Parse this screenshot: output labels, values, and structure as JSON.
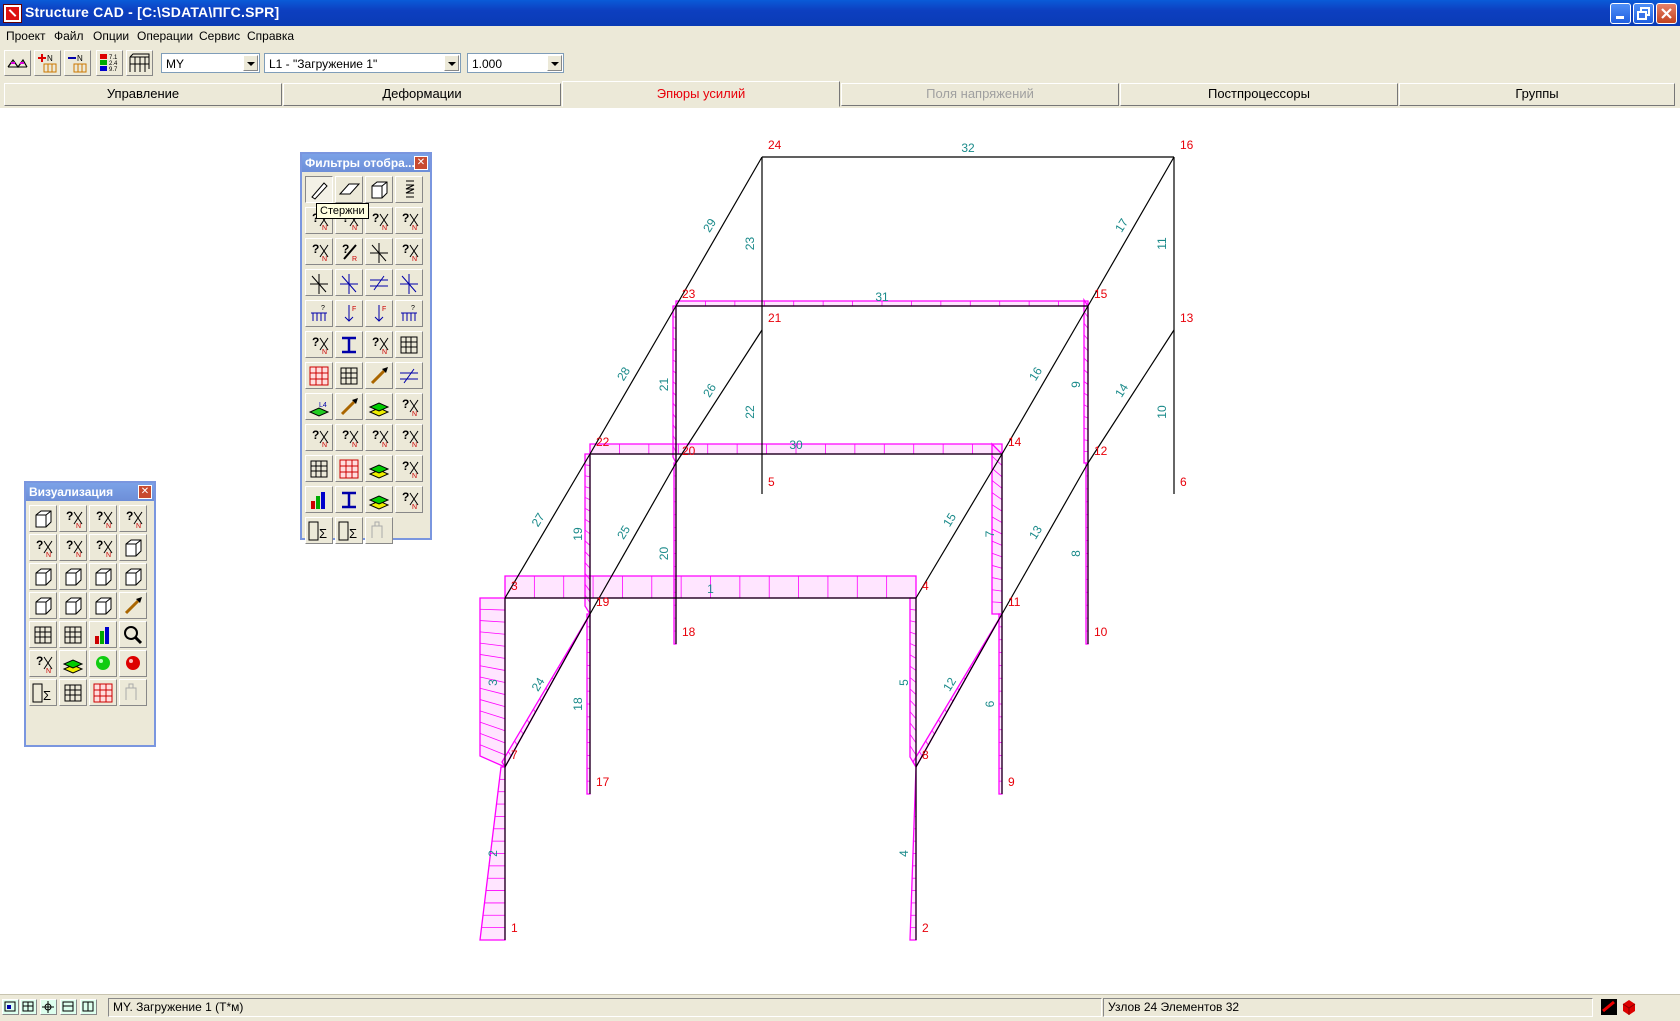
{
  "window": {
    "title": "Structure CAD  - [C:\\SDATA\\ПГС.SPR]"
  },
  "menu": [
    "Проект",
    "Файл",
    "Опции",
    "Операции",
    "Сервис",
    "Справка"
  ],
  "toolbar": {
    "combo_factor": "MY",
    "combo_load": "L1 - \"Загружение 1\"",
    "combo_scale": "1.000"
  },
  "tabs": [
    {
      "label": "Управление",
      "state": "normal"
    },
    {
      "label": "Деформации",
      "state": "normal"
    },
    {
      "label": "Эпюры усилий",
      "state": "active"
    },
    {
      "label": "Поля напряжений",
      "state": "disabled"
    },
    {
      "label": "Постпроцессоры",
      "state": "normal"
    },
    {
      "label": "Группы",
      "state": "normal"
    }
  ],
  "filters_panel": {
    "title": "Фильтры отобра...",
    "tooltip": "Стержни"
  },
  "visual_panel": {
    "title": "Визуализация"
  },
  "colors": {
    "node_label": "#e8000a",
    "element_label": "#1a8a8a",
    "diagram": "#ff00ff",
    "active_tab": "#e8000a"
  },
  "model": {
    "nodes": [
      {
        "id": "1"
      },
      {
        "id": "2"
      },
      {
        "id": "3"
      },
      {
        "id": "4"
      },
      {
        "id": "5"
      },
      {
        "id": "6"
      },
      {
        "id": "7"
      },
      {
        "id": "8"
      },
      {
        "id": "9"
      },
      {
        "id": "10"
      },
      {
        "id": "11"
      },
      {
        "id": "12"
      },
      {
        "id": "13"
      },
      {
        "id": "14"
      },
      {
        "id": "15"
      },
      {
        "id": "16"
      },
      {
        "id": "17"
      },
      {
        "id": "18"
      },
      {
        "id": "19"
      },
      {
        "id": "20"
      },
      {
        "id": "21"
      },
      {
        "id": "22"
      },
      {
        "id": "23"
      },
      {
        "id": "24"
      }
    ],
    "elements": [
      "1",
      "2",
      "3",
      "4",
      "5",
      "6",
      "7",
      "8",
      "9",
      "10",
      "11",
      "12",
      "13",
      "14",
      "15",
      "16",
      "17",
      "18",
      "19",
      "20",
      "21",
      "22",
      "23",
      "24",
      "25",
      "26",
      "27",
      "28",
      "29",
      "30",
      "31",
      "32"
    ]
  },
  "status": {
    "left": "MY. Загружение 1    (Т*м)",
    "right": "Узлов 24 Элементов 32"
  }
}
